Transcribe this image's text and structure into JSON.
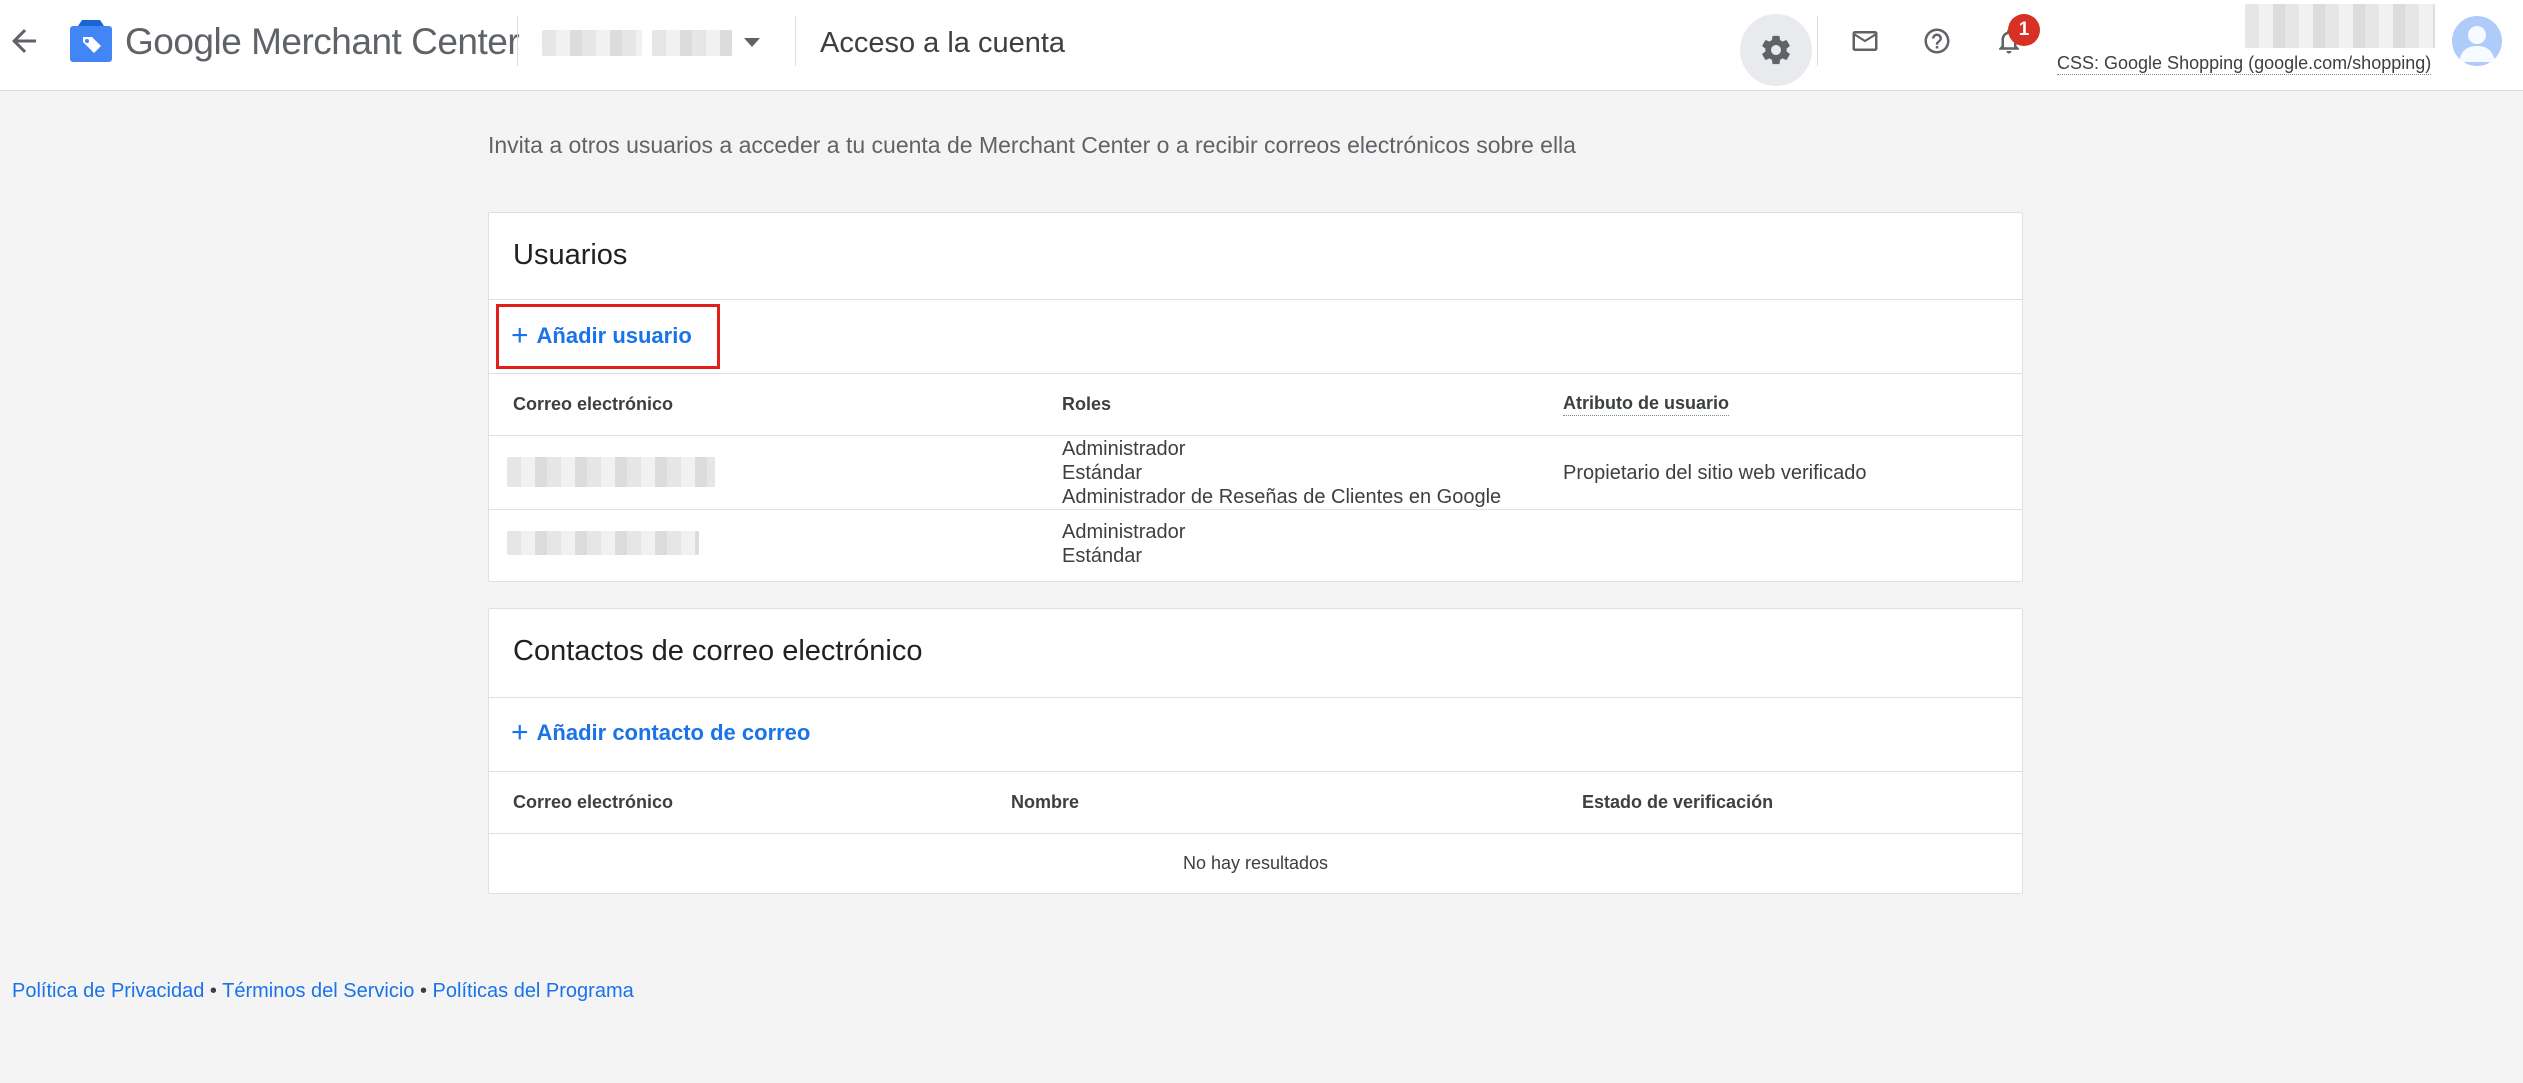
{
  "header": {
    "logo_text": "Google Merchant Center",
    "page_title": "Acceso a la cuenta",
    "notification_count": "1",
    "css_label": "CSS: Google Shopping (google.com/shopping)"
  },
  "intro": "Invita a otros usuarios a acceder a tu cuenta de Merchant Center o a recibir correos electrónicos sobre ella",
  "users": {
    "title": "Usuarios",
    "add_label": "Añadir usuario",
    "columns": [
      "Correo electrónico",
      "Roles",
      "Atributo de usuario"
    ],
    "rows": [
      {
        "roles": [
          "Administrador",
          "Estándar",
          "Administrador de Reseñas de Clientes en Google"
        ],
        "attribute": "Propietario del sitio web verificado"
      },
      {
        "roles": [
          "Administrador",
          "Estándar"
        ],
        "attribute": ""
      }
    ]
  },
  "contacts": {
    "title": "Contactos de correo electrónico",
    "add_label": "Añadir contacto de correo",
    "columns": [
      "Correo electrónico",
      "Nombre",
      "Estado de verificación"
    ],
    "empty": "No hay resultados"
  },
  "footer": {
    "privacy": "Política de Privacidad",
    "terms": "Términos del Servicio",
    "policies": "Políticas del Programa",
    "separator": "•"
  },
  "icons": {
    "back": "arrow-back-icon",
    "logo": "merchant-center-tag-icon",
    "settings": "gear-icon",
    "mail": "mail-icon",
    "help": "help-icon",
    "notifications": "bell-icon"
  },
  "colors": {
    "accent": "#1a73e8",
    "badge": "#d93025",
    "highlight": "#e0201b",
    "background": "#f4f4f4"
  }
}
